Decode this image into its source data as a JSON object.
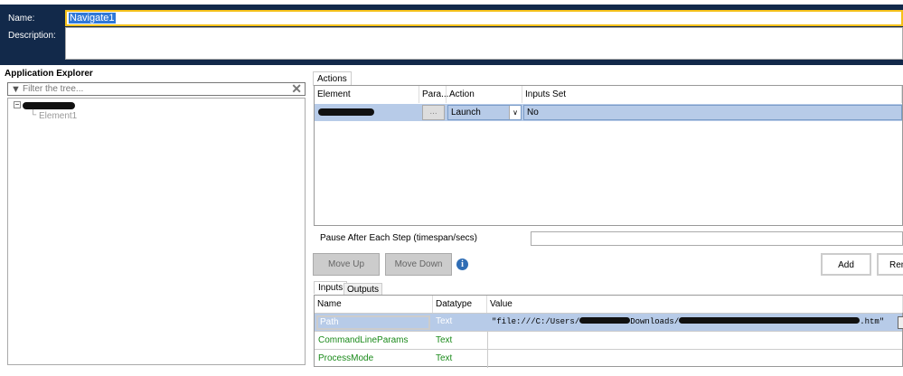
{
  "header": {
    "name_label": "Name:",
    "name_value": "Navigate1",
    "description_label": "Description:",
    "description_value": ""
  },
  "explorer": {
    "title": "Application Explorer",
    "filter_placeholder": "Filter the tree...",
    "child": "Element1"
  },
  "actions": {
    "tab": "Actions",
    "columns": [
      "Element",
      "Para...",
      "Action",
      "Inputs Set"
    ],
    "rows": [
      {
        "param_button": "...",
        "action": "Launch",
        "inputs_set": "No"
      }
    ]
  },
  "pause": {
    "label": "Pause After Each Step (timespan/secs)",
    "value": ""
  },
  "buttons": {
    "move_up": "Move Up",
    "move_down": "Move Down",
    "add": "Add",
    "remove": "Rem"
  },
  "params": {
    "tabs": [
      "Inputs",
      "Outputs"
    ],
    "columns": [
      "Name",
      "Datatype",
      "Value"
    ],
    "rows": [
      {
        "name": "Path",
        "type": "Text",
        "value_prefix": "\"file:///C:/Users/",
        "value_mid": "Downloads/",
        "value_suffix": ".htm\""
      },
      {
        "name": "CommandLineParams",
        "type": "Text"
      },
      {
        "name": "ProcessMode",
        "type": "Text"
      }
    ]
  },
  "colors": {
    "navy": "#12294a",
    "accent": "#f5c11a",
    "selection": "#b7cbe8"
  }
}
